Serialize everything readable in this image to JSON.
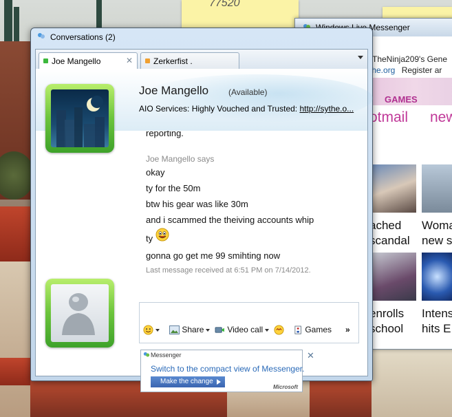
{
  "desktop": {
    "sticky_note_number": "77520"
  },
  "background_window": {
    "title": "Windows Live Messenger",
    "header_line1": "TheNinja209's Gene",
    "header_link": "the.org",
    "header_register": "Register ar",
    "games_label": "GAMES",
    "hotmail_fragment": "otmail",
    "new_fragment": "new",
    "news": [
      {
        "line1": "ached",
        "line2": "scandal"
      },
      {
        "line1": "Woma",
        "line2": "new s"
      },
      {
        "line1": "enrolls",
        "line2": "school"
      },
      {
        "line1": "Intens",
        "line2": "hits E"
      }
    ]
  },
  "window": {
    "title": "Conversations (2)",
    "tabs": [
      {
        "label": "Joe Mangello",
        "status_color": "#3cb83c"
      },
      {
        "label": "Zerkerfist .",
        "status_color": "#f0a030"
      }
    ]
  },
  "contact": {
    "name": "Joe Mangello",
    "status": "(Available)",
    "personal_message_prefix": "AIO Services: Highly Vouched and Trusted: ",
    "personal_message_link": "http://sythe.o..."
  },
  "conversation": {
    "partial_top": "reporting.",
    "sender_says": "Joe Mangello says",
    "lines": [
      "okay",
      "ty for the 50m",
      "btw his gear was like 30m",
      "and i scammed the theiving accounts whip",
      "ty",
      "gonna go get me 99 smihting now"
    ],
    "last_message": "Last message received at 6:51 PM on 7/14/2012."
  },
  "toolbar": {
    "share_label": "Share",
    "video_call_label": "Video call",
    "games_label": "Games",
    "more_label": "»"
  },
  "ad": {
    "header": "Messenger",
    "message": "Switch to the compact view of Messenger.",
    "button_label": "Make the change",
    "brand": "Microsoft"
  },
  "icons": {
    "window_icon": "messenger-buddy-icon",
    "contact_avatar": "night-city-moon-picture",
    "user_avatar": "default-messenger-person"
  }
}
